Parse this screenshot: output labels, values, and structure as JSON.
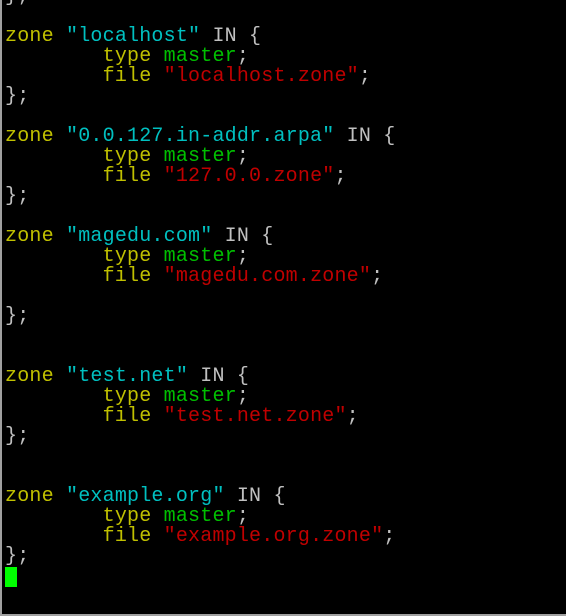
{
  "colors": {
    "keyword": "#c0c000",
    "zone_name": "#00c0c0",
    "value": "#00c000",
    "file_string": "#c00000",
    "plain": "#c0c0c0",
    "cursor": "#00ff00"
  },
  "lines": [
    {
      "t": "close",
      "text": "};"
    },
    {
      "t": "blank"
    },
    {
      "t": "zone",
      "kw": "zone",
      "name": "\"localhost\"",
      "rest": " IN {"
    },
    {
      "t": "type",
      "kw": "type",
      "val": "master"
    },
    {
      "t": "file",
      "kw": "file",
      "val": "\"localhost.zone\""
    },
    {
      "t": "close",
      "text": "};"
    },
    {
      "t": "blank"
    },
    {
      "t": "zone",
      "kw": "zone",
      "name": "\"0.0.127.in-addr.arpa\"",
      "rest": " IN {"
    },
    {
      "t": "type",
      "kw": "type",
      "val": "master"
    },
    {
      "t": "file",
      "kw": "file",
      "val": "\"127.0.0.zone\""
    },
    {
      "t": "close",
      "text": "};"
    },
    {
      "t": "blank"
    },
    {
      "t": "zone",
      "kw": "zone",
      "name": "\"magedu.com\"",
      "rest": " IN {"
    },
    {
      "t": "type",
      "kw": "type",
      "val": "master"
    },
    {
      "t": "file",
      "kw": "file",
      "val": "\"magedu.com.zone\""
    },
    {
      "t": "blank"
    },
    {
      "t": "close",
      "text": "};"
    },
    {
      "t": "blank"
    },
    {
      "t": "blank"
    },
    {
      "t": "zone",
      "kw": "zone",
      "name": "\"test.net\"",
      "rest": " IN {"
    },
    {
      "t": "type",
      "kw": "type",
      "val": "master"
    },
    {
      "t": "file",
      "kw": "file",
      "val": "\"test.net.zone\""
    },
    {
      "t": "close",
      "text": "};"
    },
    {
      "t": "blank"
    },
    {
      "t": "blank"
    },
    {
      "t": "zone",
      "kw": "zone",
      "name": "\"example.org\"",
      "rest": " IN {"
    },
    {
      "t": "type",
      "kw": "type",
      "val": "master"
    },
    {
      "t": "file",
      "kw": "file",
      "val": "\"example.org.zone\""
    },
    {
      "t": "close",
      "text": "};"
    },
    {
      "t": "cursor"
    }
  ]
}
